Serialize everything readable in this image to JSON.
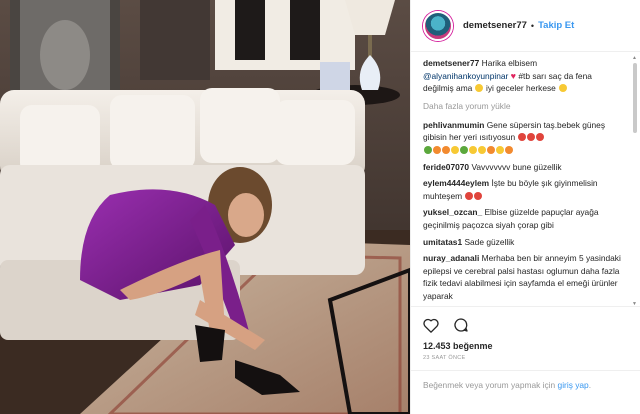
{
  "post": {
    "username": "demetsener77",
    "follow_label": "Takip Et",
    "caption_user": "demetsener77",
    "caption_text_1": "Harika elbisem",
    "caption_mention": "@alyanihankoyunpinar",
    "caption_text_2": "#tb sarı saç da fena değilmiş ama",
    "caption_text_3": "iyi geceler herkese",
    "load_more": "Daha fazla yorum yükle",
    "comments": [
      {
        "user": "pehlivanmumin",
        "text": "Gene süpersin taş.bebek güneş gibisin her yeri ısıtıyosun"
      },
      {
        "user": "feride07070",
        "text": "Vavvvvvvv bune güzellik"
      },
      {
        "user": "eylem4444eylem",
        "text": "İşte bu böyle şık giyinmelisin muhteşem"
      },
      {
        "user": "yuksel_ozcan_",
        "text": "Elbise güzelde papuçlar ayağa geçinilmiş paçozca siyah çorap gibi"
      },
      {
        "user": "umitatas1",
        "text": "Sade güzellik"
      },
      {
        "user": "nuray_adanali",
        "text": "Merhaba ben bir anneyim 5 yasindaki epilepsi ve cerebral palsi hastası oglumun daha fazla fizik tedavi alabilmesi için sayfamda el emeği ürünler yaparak"
      }
    ],
    "likes": "12.453 beğenme",
    "time_ago": "23 SAAT ÖNCE",
    "login_prefix": "Beğenmek veya yorum yapmak için",
    "login_link": "giriş yap",
    "login_suffix": "."
  },
  "icons": [
    "heart-icon",
    "comment-icon",
    "avatar"
  ],
  "colors": {
    "link": "#3897f0",
    "text": "#262626",
    "muted": "#999999",
    "dress": "#7a1f8a"
  }
}
